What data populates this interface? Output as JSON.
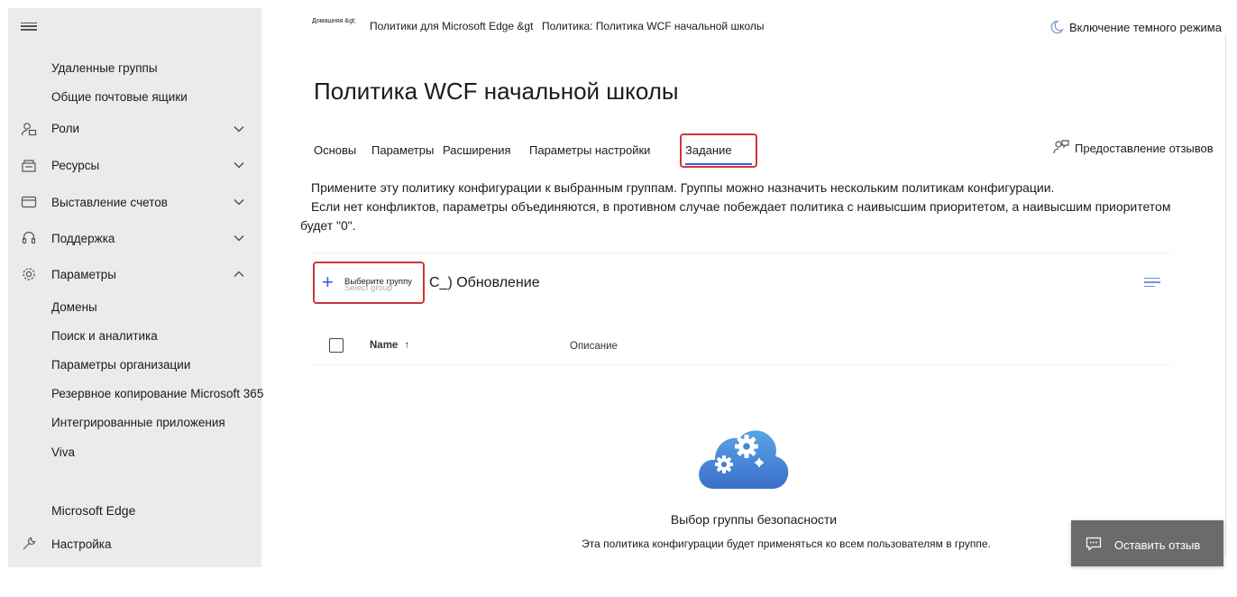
{
  "sidebar": {
    "items": [
      {
        "label": "Удаленные группы"
      },
      {
        "label": "Общие почтовые ящики"
      },
      {
        "label": "Роли",
        "icon": "roles-icon"
      },
      {
        "label": "Ресурсы",
        "icon": "resources-icon"
      },
      {
        "label": "Выставление счетов",
        "icon": "billing-icon"
      },
      {
        "label": "Поддержка",
        "icon": "headset-icon"
      },
      {
        "label": "Параметры",
        "icon": "gear-icon"
      },
      {
        "label": "Домены"
      },
      {
        "label": "Поиск и аналитика"
      },
      {
        "label": "Параметры организации"
      },
      {
        "label": "Резервное копирование Microsoft 365"
      },
      {
        "label": "Интегрированные приложения"
      },
      {
        "label": "Viva"
      },
      {
        "label": "Microsoft Edge"
      },
      {
        "label": "Настройка",
        "icon": "wrench-icon"
      }
    ]
  },
  "header": {
    "breadcrumb_home": "Домашняя &gt;",
    "breadcrumb_policies": "Политики для Microsoft Edge &gt",
    "breadcrumb_current": "Политика: Политика WCF начальной школы",
    "dark_mode": "Включение темного режима"
  },
  "page": {
    "title": "Политика WCF начальной школы",
    "feedback_link": "Предоставление отзывов"
  },
  "tabs": [
    {
      "label": "Основы"
    },
    {
      "label": "Параметры"
    },
    {
      "label": "Расширения"
    },
    {
      "label": "Параметры настройки"
    },
    {
      "label": "Задание",
      "active": true
    }
  ],
  "description": {
    "line1": "Примените эту политику конфигурации к выбранным группам. Группы можно назначить нескольким политикам конфигурации.",
    "line2": "Если нет конфликтов, параметры объединяются, в противном случае побеждает политика с наивысшим приоритетом, а наивысшим приоритетом",
    "line3": "будет \"0\"."
  },
  "commandbar": {
    "select_group": "Выберите группу",
    "select_group_ghost": "Select group",
    "refresh": "C_) Обновление"
  },
  "table": {
    "col_name": "Name",
    "sort_arrow": "↑",
    "col_description": "Описание"
  },
  "empty_state": {
    "title": "Выбор группы безопасности",
    "text": "Эта политика конфигурации будет применяться ко всем пользователям в группе."
  },
  "feedback_button": {
    "label": "Оставить отзыв"
  },
  "colors": {
    "accent": "#3b5bdb",
    "highlight": "#d13438",
    "sidebar_bg": "#ebebeb",
    "fab_bg": "#6b6b6b"
  }
}
